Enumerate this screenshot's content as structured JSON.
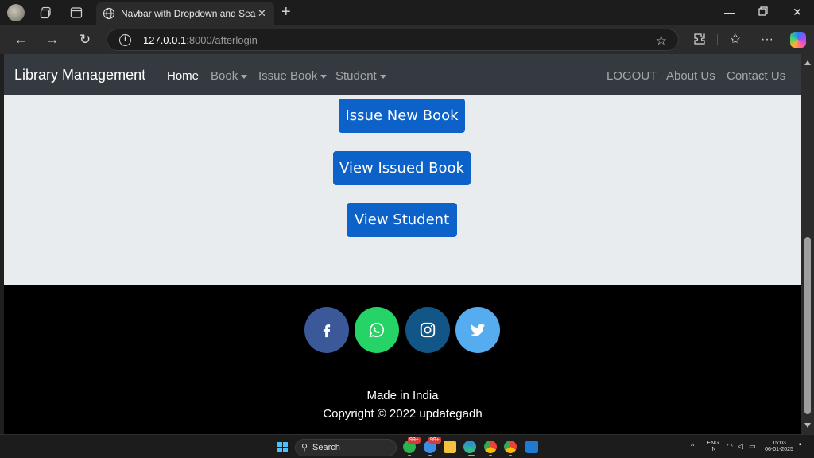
{
  "browser": {
    "tab_title": "Navbar with Dropdown and Search",
    "url_host": "127.0.0.1",
    "url_rest": ":8000/afterlogin"
  },
  "navbar": {
    "brand": "Library Management",
    "items": [
      {
        "label": "Home",
        "active": true,
        "dropdown": false
      },
      {
        "label": "Book",
        "active": false,
        "dropdown": true
      },
      {
        "label": "Issue Book",
        "active": false,
        "dropdown": true
      },
      {
        "label": "Student",
        "active": false,
        "dropdown": true
      }
    ],
    "right_items": [
      {
        "label": "LOGOUT"
      },
      {
        "label": "About Us"
      },
      {
        "label": "Contact Us"
      }
    ]
  },
  "main": {
    "buttons": [
      {
        "label": "Issue New Book"
      },
      {
        "label": "View Issued Book"
      },
      {
        "label": "View Student"
      }
    ]
  },
  "footer": {
    "social": [
      {
        "icon": "facebook-icon",
        "color": "#3b5998"
      },
      {
        "icon": "whatsapp-icon",
        "color": "#25d366"
      },
      {
        "icon": "instagram-icon",
        "color": "#125688"
      },
      {
        "icon": "twitter-icon",
        "color": "#55acee"
      }
    ],
    "made_in": "Made in India",
    "copyright": "Copyright © 2022 updategadh"
  },
  "taskbar": {
    "search_label": "Search",
    "badge_1": "99+",
    "badge_2": "99+",
    "lang_1": "ENG",
    "lang_2": "IN",
    "time": "15:03",
    "date": "06-01-2025"
  },
  "colors": {
    "navbar_bg": "#343a40",
    "page_bg": "#e9ecef",
    "button_primary": "#0d62c9",
    "footer_bg": "#000000"
  }
}
